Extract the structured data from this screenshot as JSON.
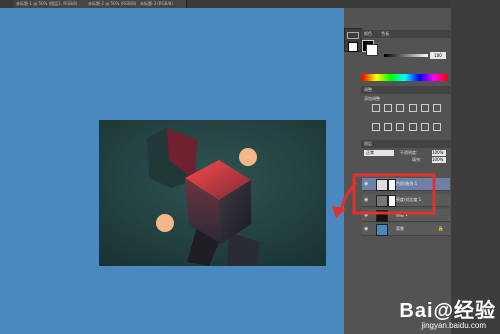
{
  "topbar": {
    "tabs": [
      "未标题-1 @ 50% (图层1, RGB/8)",
      "未标题-2 @ 50% (RGB/8)",
      "未标题-3 (RGB/8)"
    ]
  },
  "panels": {
    "color_tab": "颜色",
    "swatch_tab": "色板",
    "adjust_tab": "调整",
    "adjust_title": "添加调整",
    "layers_tab": "图层",
    "blend_mode": "正常",
    "opacity_label": "不透明度:",
    "opacity_value": "100%",
    "fill_label": "填充:",
    "fill_value": "100%",
    "color_value": "100"
  },
  "layers": [
    {
      "name": "色阶/曲线 1",
      "selected": true
    },
    {
      "name": "亮度/对比度 1",
      "selected": false
    },
    {
      "name": "图层 1",
      "selected": false
    },
    {
      "name": "背景",
      "selected": false
    }
  ],
  "watermark": {
    "text": "Bai@经验",
    "url": "jingyan.baidu.com"
  },
  "colors": {
    "canvas_bg": "#4a89c0",
    "panel_bg": "#535353",
    "selected_layer": "#6e7fa8",
    "annotation": "#e03030"
  }
}
